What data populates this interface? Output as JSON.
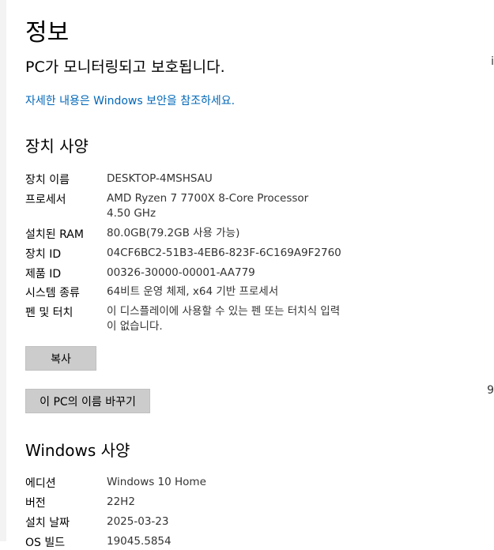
{
  "page_title": "정보",
  "protection_status": "PC가 모니터링되고 보호됩니다.",
  "security_link": "자세한 내용은 Windows 보안을 참조하세요.",
  "device_specs": {
    "heading": "장치 사양",
    "rows": [
      {
        "label": "장치 이름",
        "value": "DESKTOP-4MSHSAU"
      },
      {
        "label": "프로세서",
        "value": "AMD Ryzen 7 7700X 8-Core Processor",
        "value2": "4.50 GHz"
      },
      {
        "label": "설치된 RAM",
        "value": "80.0GB(79.2GB 사용 가능)"
      },
      {
        "label": "장치 ID",
        "value": "04CF6BC2-51B3-4EB6-823F-6C169A9F2760"
      },
      {
        "label": "제품 ID",
        "value": "00326-30000-00001-AA779"
      },
      {
        "label": "시스템 종류",
        "value": "64비트 운영 체제, x64 기반 프로세서"
      },
      {
        "label": "펜 및 터치",
        "value": "이 디스플레이에 사용할 수 있는 펜 또는 터치식 입력",
        "value2": "이 없습니다."
      }
    ],
    "copy_button": "복사",
    "rename_button": "이 PC의 이름 바꾸기"
  },
  "windows_specs": {
    "heading": "Windows 사양",
    "rows": [
      {
        "label": "에디션",
        "value": "Windows 10 Home"
      },
      {
        "label": "버전",
        "value": "22H2"
      },
      {
        "label": "설치 날짜",
        "value": "2025-03-23"
      },
      {
        "label": "OS 빌드",
        "value": "19045.5854"
      }
    ]
  },
  "right_edge_glyphs": [
    "i",
    "9"
  ]
}
